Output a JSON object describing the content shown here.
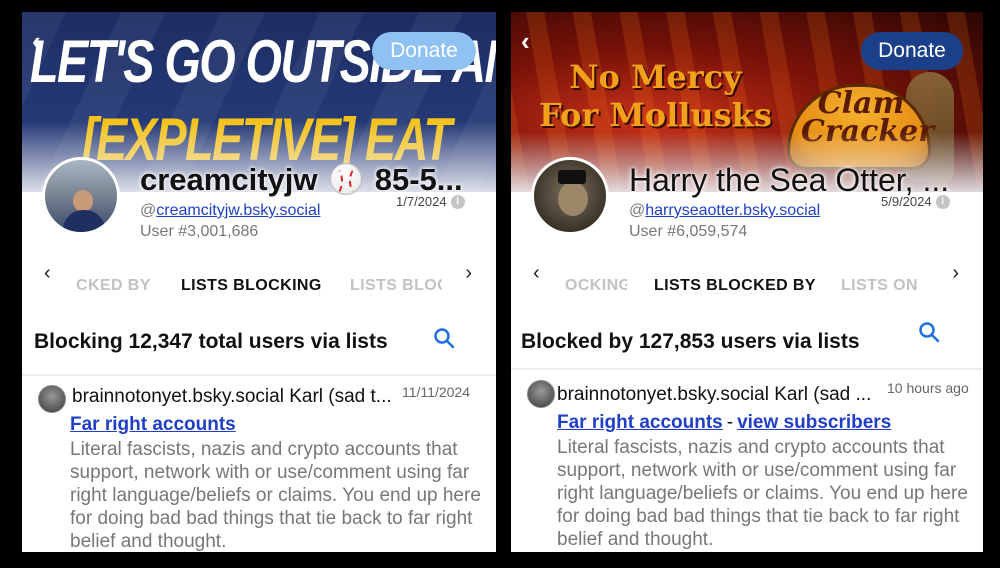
{
  "left": {
    "banner": {
      "line1": "LET'S GO OUTSIDE AND",
      "line2": "[EXPLETIVE] EAT"
    },
    "back_icon": "back-arrow-icon",
    "donate_label": "Donate",
    "profile": {
      "display_name": "creamcityjw",
      "name_suffix": "85-5...",
      "date": "1/7/2024",
      "handle_prefix": "@",
      "handle": "creamcityjw.bsky.social",
      "user_number": "User #3,001,686"
    },
    "tabs": {
      "prev": "CKED BY",
      "active": "LISTS BLOCKING",
      "next": "LISTS BLOC"
    },
    "summary": "Blocking 12,347 total users via lists",
    "item": {
      "author": "brainnotonyet.bsky.social Karl (sad t...",
      "time": "11/11/2024",
      "links": [
        "Far right accounts"
      ],
      "description": "Literal fascists, nazis and crypto accounts that support, network with or use/comment using far right language/beliefs or claims. You end up here for doing bad bad things that tie back to far right belief and thought."
    }
  },
  "right": {
    "banner": {
      "line1": "No Mercy",
      "line2": "For Mollusks",
      "logo_line1": "Clam",
      "logo_line2": "Cracker"
    },
    "back_icon": "back-arrow-icon",
    "donate_label": "Donate",
    "profile": {
      "display_name": "Harry the Sea Otter, ...",
      "date": "5/9/2024",
      "handle_prefix": "@",
      "handle": "harryseaotter.bsky.social",
      "user_number": "User #6,059,574"
    },
    "tabs": {
      "prev": "OCKING",
      "active": "LISTS BLOCKED BY",
      "next": "LISTS ON"
    },
    "summary": "Blocked by 127,853 users via lists",
    "item": {
      "author": "brainnotonyet.bsky.social Karl (sad ...",
      "time": "10 hours ago",
      "links": [
        "Far right accounts",
        "view subscribers"
      ],
      "separator": "-",
      "description": "Literal fascists, nazis and crypto accounts that support, network with or use/comment using far right language/beliefs or claims. You end up here for doing bad bad things that tie back to far right belief and thought."
    }
  },
  "colors": {
    "link": "#1f3fc5",
    "donate_left": "#8fc2f2",
    "donate_right": "#1c3f8a",
    "background": "#000000"
  }
}
